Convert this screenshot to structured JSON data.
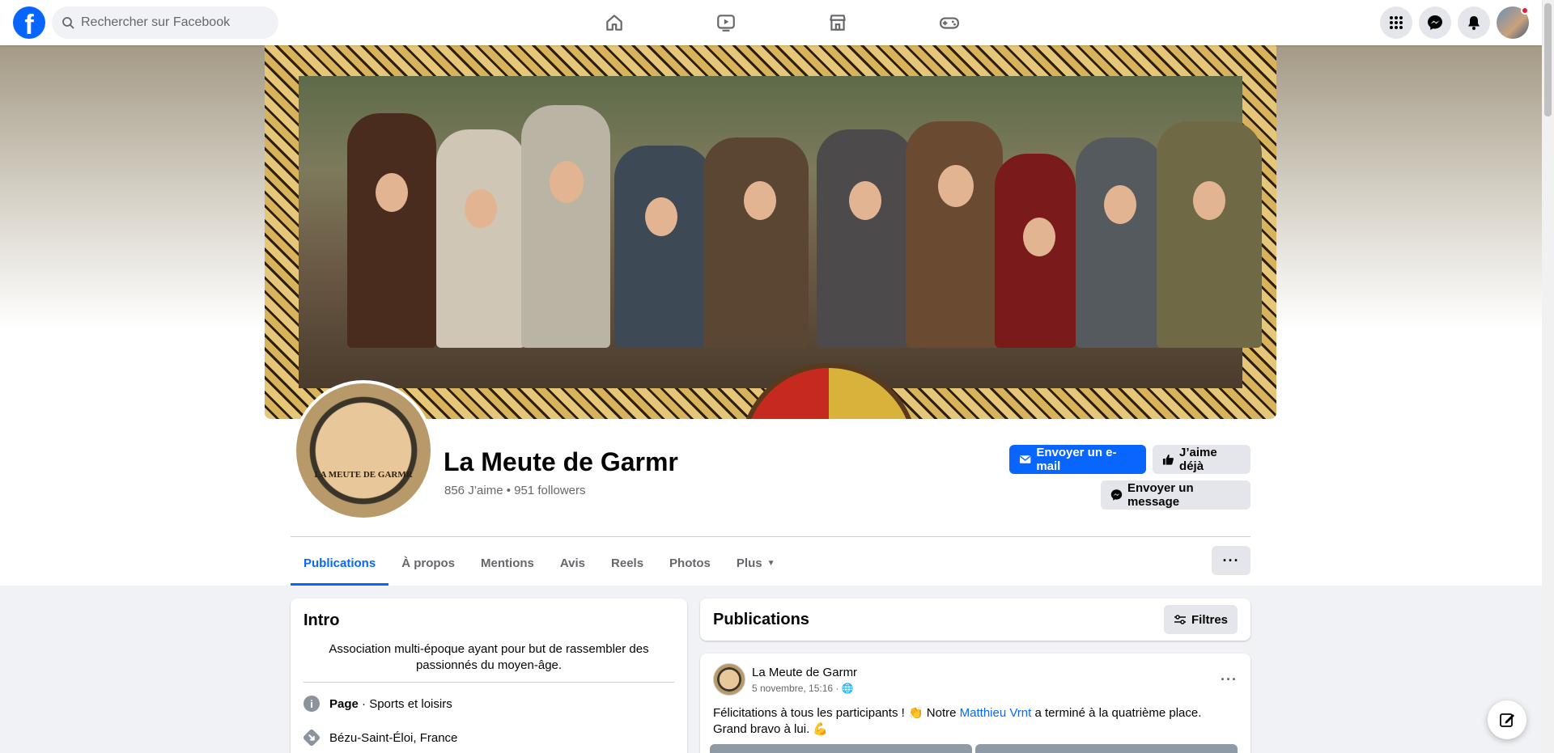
{
  "topbar": {
    "logo": "f",
    "search_placeholder": "Rechercher sur Facebook",
    "nav_icons": [
      "home-icon",
      "video-icon",
      "marketplace-icon",
      "gaming-icon"
    ],
    "right_icons": [
      "menu-grid-icon",
      "messenger-icon",
      "bell-icon"
    ]
  },
  "page": {
    "name": "La Meute de Garmr",
    "stats": "856 J’aime • 951 followers",
    "logo_text": "LA MEUTE DE GARMR"
  },
  "actions": {
    "email": "Envoyer un e-mail",
    "like": "J’aime déjà",
    "message": "Envoyer un message"
  },
  "tabs": [
    {
      "label": "Publications",
      "active": true
    },
    {
      "label": "À propos"
    },
    {
      "label": "Mentions"
    },
    {
      "label": "Avis"
    },
    {
      "label": "Reels"
    },
    {
      "label": "Photos"
    },
    {
      "label": "Plus"
    }
  ],
  "intro": {
    "title": "Intro",
    "description": "Association multi-époque ayant pour but de rassembler des passionnés du moyen-âge.",
    "category_label": "Page",
    "category_value": " · Sports et loisirs",
    "location": "Bézu-Saint-Éloi, France"
  },
  "publications": {
    "title": "Publications",
    "filter": "Filtres"
  },
  "post": {
    "author": "La Meute de Garmr",
    "date": "5 novembre, 15:16 · ",
    "text_before": "Félicitations à tous les participants ! 👏 Notre ",
    "mention": "Matthieu Vrnt",
    "text_after": " a terminé à la quatrième place. Grand bravo à lui. 💪"
  },
  "colors": {
    "accent": "#0866ff",
    "background": "#f0f2f5"
  }
}
